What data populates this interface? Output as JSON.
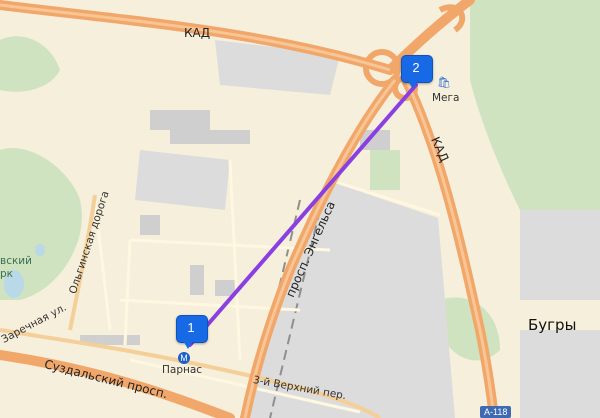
{
  "roads": {
    "kad_top": "КАД",
    "kad_right": "КАД",
    "engelsa": "просп. Энгельса",
    "suzdalsky": "Суздальский просп.",
    "olginskaya": "Ольгинская дорога",
    "zarechnaya": "Заречная ул.",
    "verkhny": "3-й Верхний пер.",
    "route_shield": "А-118"
  },
  "places": {
    "bugry": "Бугры",
    "forest_a": "вский",
    "forest_b": "рк"
  },
  "pois": {
    "mega": {
      "label": "Мега",
      "icon": "shopping-bag-icon"
    },
    "parnas": {
      "label": "Парнас",
      "icon": "metro-icon",
      "glyph": "М"
    }
  },
  "markers": [
    {
      "label": "1"
    },
    {
      "label": "2"
    }
  ],
  "colors": {
    "route": "#8a3fe0",
    "marker": "#1769e6",
    "highway": "#f2a76a",
    "land": "#f6efdc",
    "industrial": "#dedede",
    "green": "#cfe3c0"
  }
}
